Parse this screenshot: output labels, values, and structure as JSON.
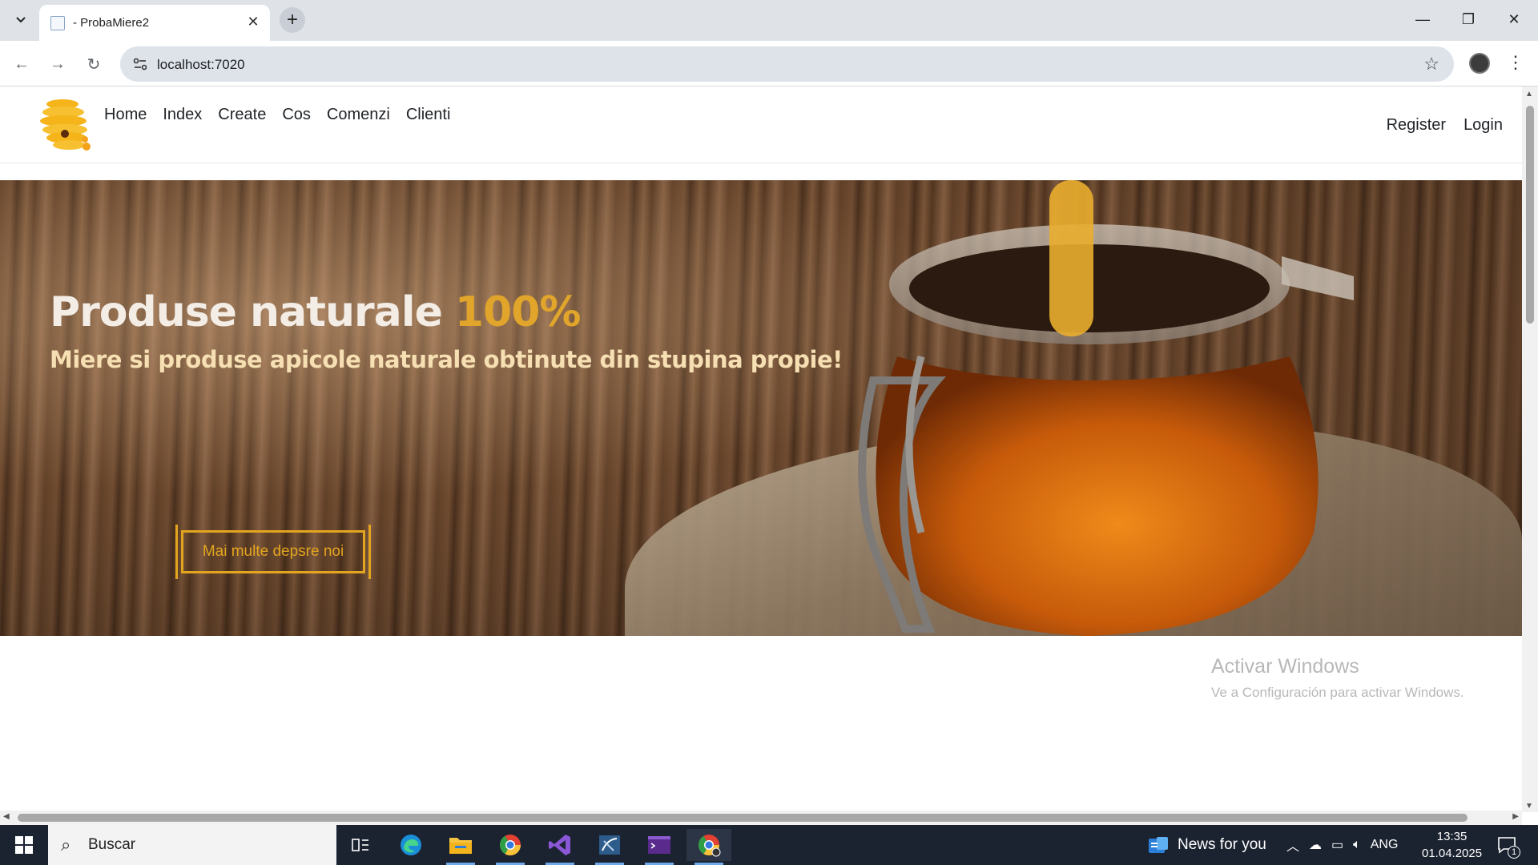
{
  "browser": {
    "tab_title": "- ProbaMiere2",
    "new_tab": "+",
    "close_tab": "✕",
    "url": "localhost:7020",
    "window_controls": {
      "minimize": "—",
      "restore": "❐",
      "close": "✕"
    }
  },
  "site": {
    "nav": [
      "Home",
      "Index",
      "Create",
      "Cos",
      "Comenzi",
      "Clienti"
    ],
    "auth": [
      "Register",
      "Login"
    ]
  },
  "hero": {
    "title": "Produse naturale",
    "title_accent": "100%",
    "subtitle": "Miere si produse apicole naturale obtinute din stupina propie!",
    "button": "Mai multe depsre noi"
  },
  "watermark": {
    "line1": "Activar Windows",
    "line2": "Ve a Configuración para activar Windows."
  },
  "taskbar": {
    "search_placeholder": "Buscar",
    "news": "News for you",
    "language": "ANG",
    "time": "13:35",
    "date": "01.04.2025",
    "notifications": "1"
  },
  "colors": {
    "accent": "#e3a51f",
    "hero_title": "#f3ede6",
    "hero_sub": "#f6dfb2",
    "taskbar": "#1b2230"
  }
}
